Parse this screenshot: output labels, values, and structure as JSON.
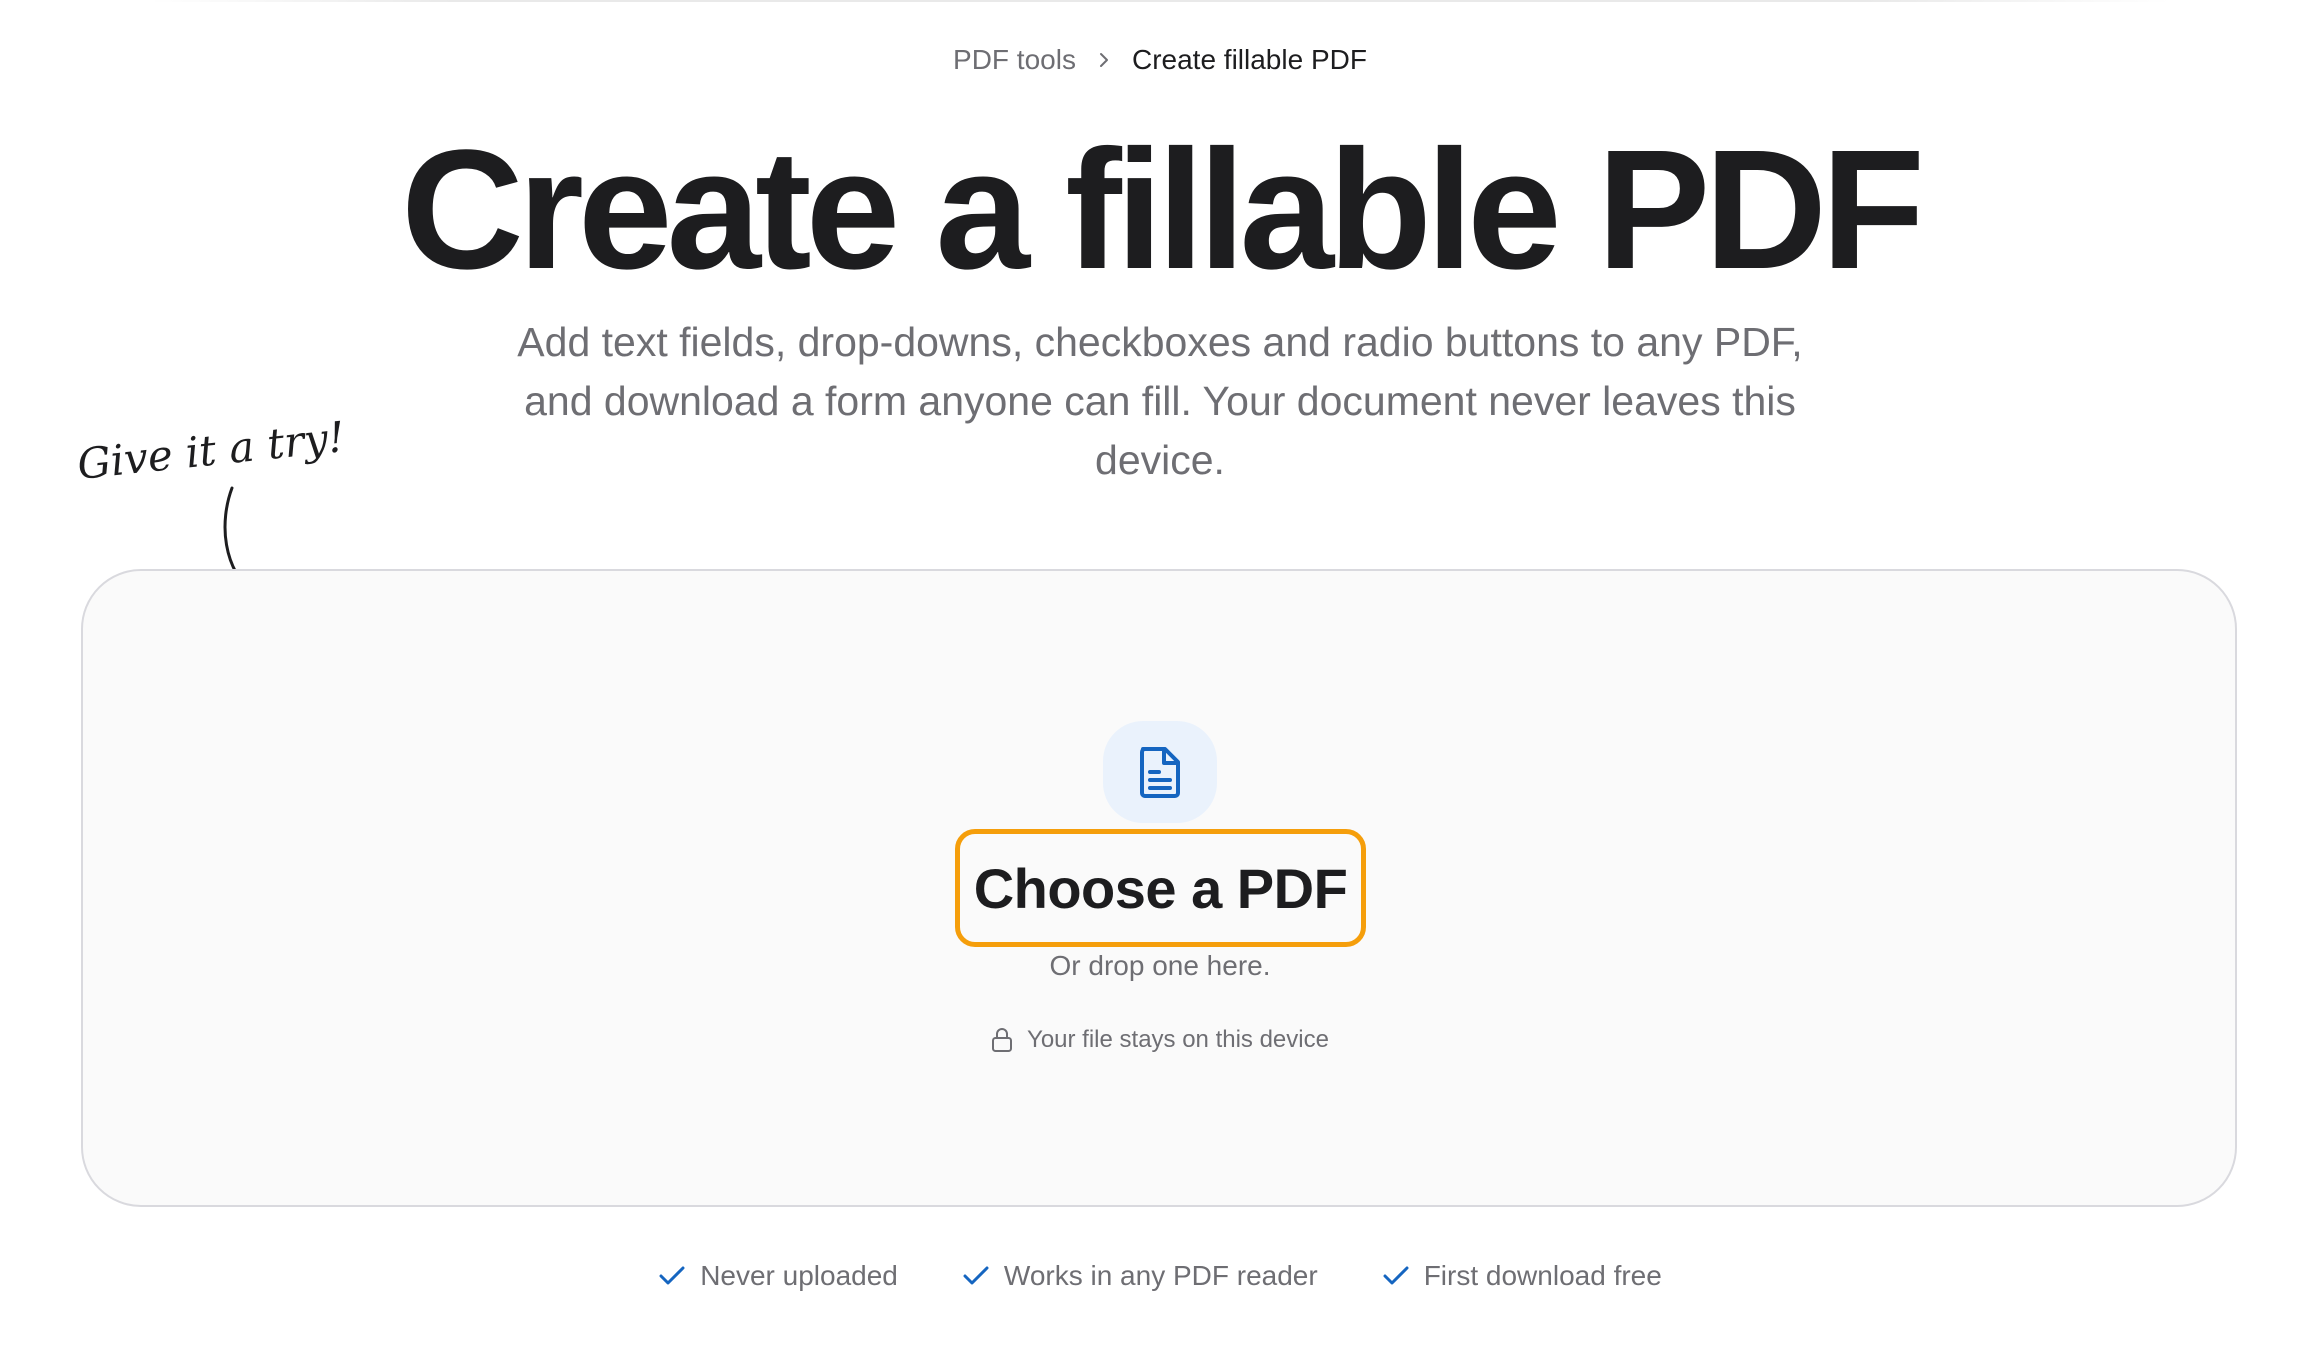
{
  "breadcrumb": {
    "parent": "PDF tools",
    "current": "Create fillable PDF"
  },
  "hero": {
    "title": "Create a fillable PDF",
    "subtitle": "Add text fields, drop-downs, checkboxes and radio buttons to any PDF, and download a form anyone can fill. Your document never leaves this device."
  },
  "annotation": {
    "text": "Give it a try!"
  },
  "dropzone": {
    "icon": "document-icon",
    "button_label": "Choose a PDF",
    "hint": "Or drop one here.",
    "privacy_icon": "lock-icon",
    "privacy_text": "Your file stays on this device"
  },
  "features": [
    {
      "icon": "check-icon",
      "label": "Never uploaded"
    },
    {
      "icon": "check-icon",
      "label": "Works in any PDF reader"
    },
    {
      "icon": "check-icon",
      "label": "First download free"
    }
  ],
  "colors": {
    "accent_blue": "#1565c0",
    "button_outline": "#f59e0b",
    "text_primary": "#1d1d1f",
    "text_secondary": "#6e6e73",
    "dropzone_bg": "#fafafa"
  }
}
